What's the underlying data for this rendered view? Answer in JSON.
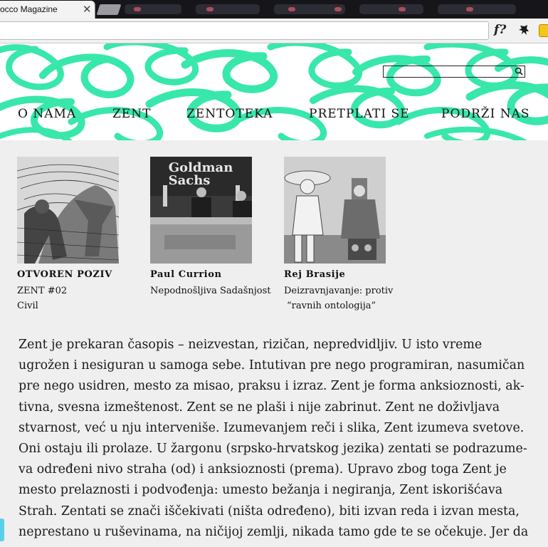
{
  "browser": {
    "tab_title": "occo Magazine",
    "tab_close": "✕",
    "extension_f": "f?"
  },
  "search": {
    "placeholder": "",
    "value": ""
  },
  "nav": [
    "O NAMA",
    "ZENT",
    "ZENTOTEKA",
    "PRETPLATI SE",
    "PODRŽI NAS"
  ],
  "colors": {
    "accent_mint": "#2ee6a6",
    "background": "#efefef"
  },
  "cards": [
    {
      "title": "OTVOREN POZIV",
      "lines": [
        "ZENT #02",
        "Civil"
      ],
      "image": "engraving-illustration"
    },
    {
      "title": "Paul Currion",
      "lines": [
        "Nepodnošljiva Sadašnjost"
      ],
      "image": "goldman-sachs-meeting-photo",
      "image_text": [
        "Goldman",
        "Sachs"
      ]
    },
    {
      "title": "Rej Brasije",
      "lines": [
        "Deizravnjavanje: protiv",
        "“ravnih ontologija”"
      ],
      "image": "collage-figures"
    }
  ],
  "intro_lines": [
    "Zent je prekaran časopis – neizvestan, rizičan, nepredvidljiv. U isto vreme",
    "ugrožen i nesiguran u samoga sebe. Intutivan pre nego programiran, nasumičan",
    "pre nego usidren, mesto za misao, praksu i izraz. Zent je forma anksioznosti, ak-",
    "tivna, svesna izmeštenost. Zent se ne plaši i nije zabrinut. Zent ne doživljava",
    "stvarnost, već u nju interveniše. Izumevanjem reči i slika, Zent izumeva svetove.",
    "Oni ostaju ili prolaze. U žargonu (srpsko-hrvatskog jezika) zentati se podrazume-",
    "va određeni nivo straha (od) i anksioznosti (prema). Upravo zbog toga Zent je",
    "mesto prelaznosti i podvođenja: umesto bežanja i negiranja, Zent iskorišćava",
    "Strah. Zentati se znači iščekivati (ništa određeno), biti izvan reda i izvan mesta,",
    "neprestano u ruševinama, na ničijoj zemlji, nikada tamo gde te se očekuje. Jer da"
  ]
}
